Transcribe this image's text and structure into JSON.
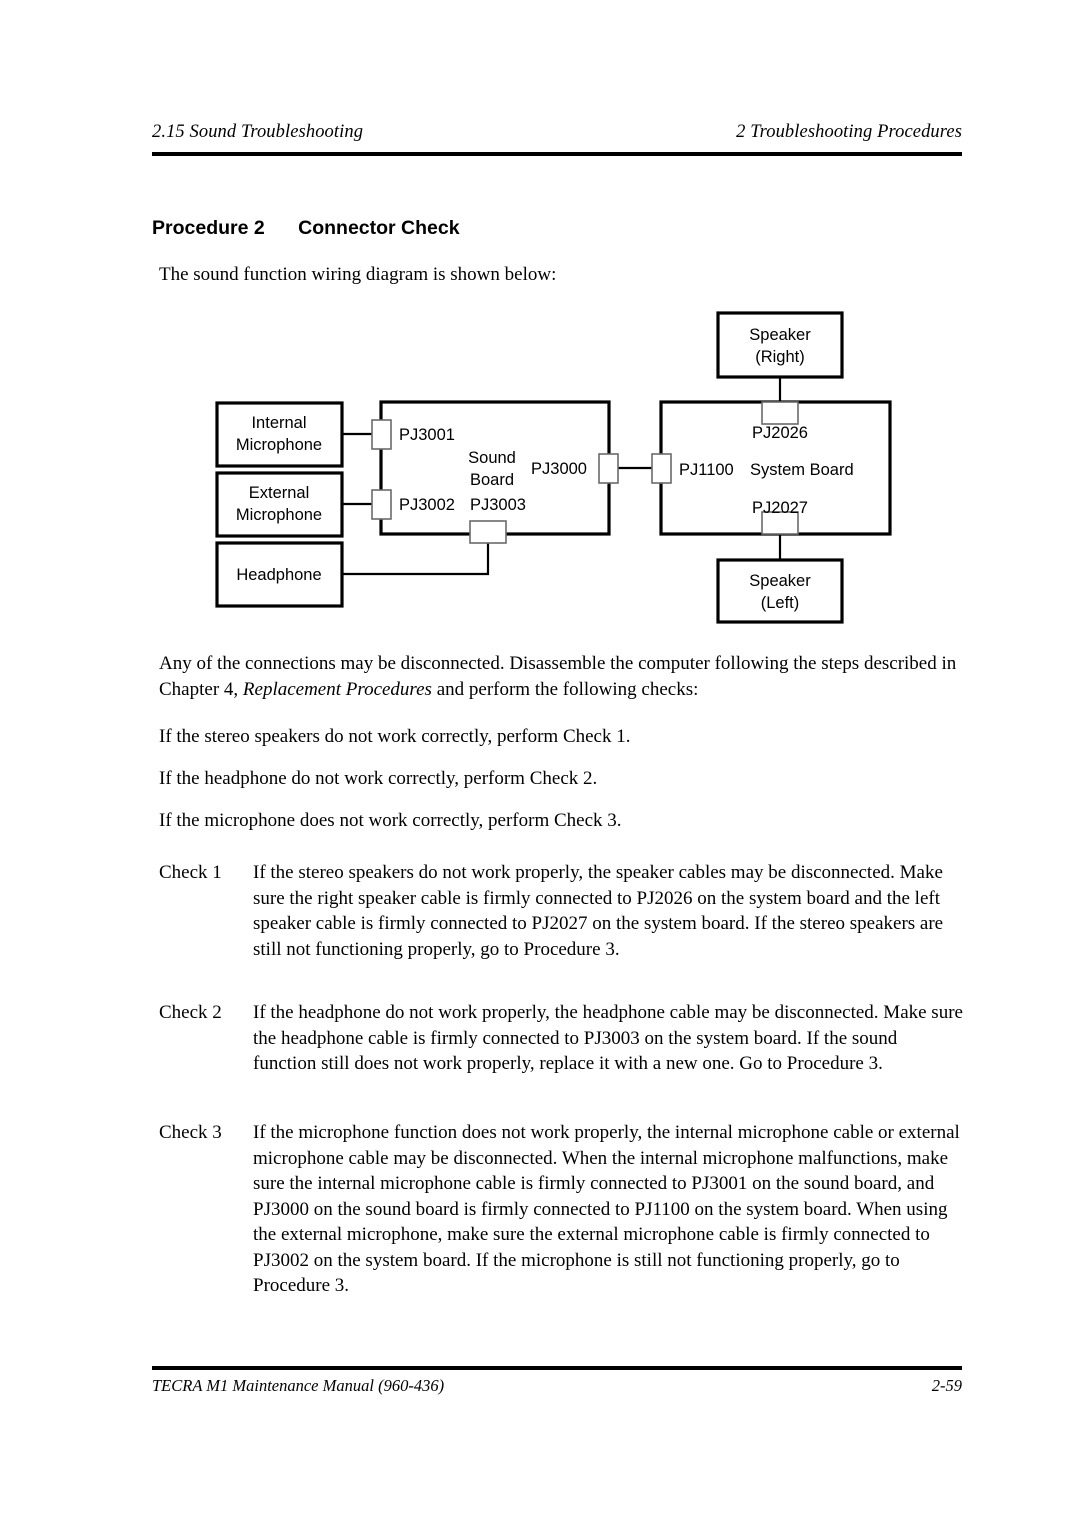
{
  "header": {
    "left": "2.15 Sound Troubleshooting",
    "right": "2  Troubleshooting Procedures"
  },
  "heading": {
    "procedure_label": "Procedure 2",
    "title": "Connector Check"
  },
  "intro": "The sound function wiring diagram is shown below:",
  "diagram": {
    "boxes": {
      "internal_microphone": {
        "line1": "Internal",
        "line2": "Microphone"
      },
      "external_microphone": {
        "line1": "External",
        "line2": "Microphone"
      },
      "headphone": {
        "line1": "Headphone"
      },
      "sound_board": {
        "line1": "Sound",
        "line2": "Board"
      },
      "system_board": {
        "line1": "System Board"
      },
      "speaker_right": {
        "line1": "Speaker",
        "line2": "(Right)"
      },
      "speaker_left": {
        "line1": "Speaker",
        "line2": "(Left)"
      }
    },
    "connectors": {
      "pj3001": "PJ3001",
      "pj3002": "PJ3002",
      "pj3003": "PJ3003",
      "pj3000": "PJ3000",
      "pj1100": "PJ1100",
      "pj2026": "PJ2026",
      "pj2027": "PJ2027"
    }
  },
  "body": {
    "after_diagram_part1": "Any of the connections may be disconnected. Disassemble the computer following the steps described in Chapter 4, ",
    "after_diagram_italic": "Replacement Procedures",
    "after_diagram_part2": " and perform the following checks:",
    "line_check1": "If the stereo speakers do not work correctly, perform Check 1.",
    "line_check2": "If the headphone do not work correctly, perform Check 2.",
    "line_check3": "If the microphone does not work correctly, perform Check 3."
  },
  "checks": [
    {
      "tag": "Check 1",
      "text": "If the stereo speakers do not work properly, the speaker cables may be disconnected. Make sure the right speaker cable is firmly connected to PJ2026 on the system board and the left speaker cable is firmly connected to PJ2027 on the system board. If the stereo speakers are still not functioning properly, go to Procedure 3."
    },
    {
      "tag": "Check 2",
      "text": "If the headphone do not work properly, the headphone cable may be disconnected. Make sure the headphone cable is firmly connected to PJ3003 on the system board.  If the sound function still does not work properly, replace it with a new one. Go to Procedure 3."
    },
    {
      "tag": "Check 3",
      "text": "If the microphone function does not work properly, the internal microphone cable or external microphone cable may be disconnected. When the internal microphone malfunctions, make sure the internal microphone cable is firmly connected to PJ3001 on the sound board, and PJ3000 on the sound board is firmly connected to PJ1100 on the system board. When using the external microphone, make sure the external microphone cable is firmly connected to PJ3002 on the system board. If the microphone is still not functioning properly, go to Procedure 3."
    }
  ],
  "footer": {
    "left": "TECRA M1 Maintenance Manual (960-436)",
    "right": "2-59"
  }
}
